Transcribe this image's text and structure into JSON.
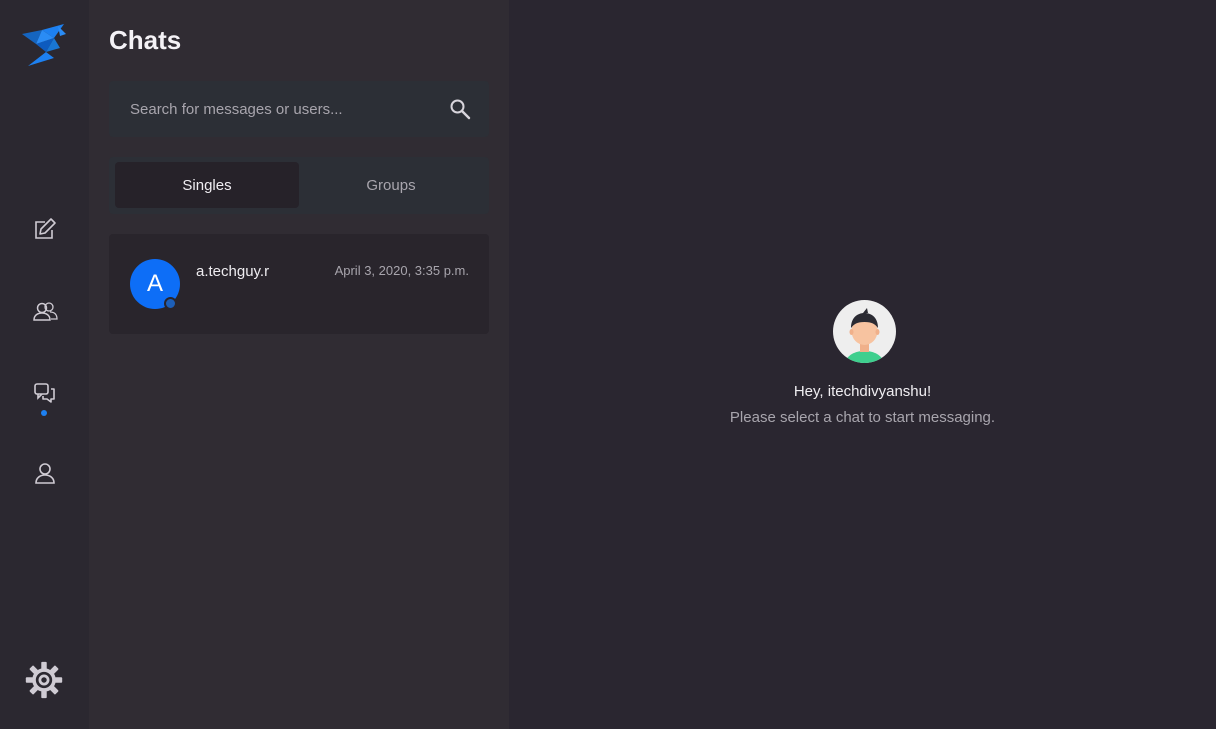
{
  "sidebar": {
    "logo_icon": "bird-logo-icon",
    "nav": [
      {
        "icon": "edit-icon",
        "active": false
      },
      {
        "icon": "users-icon",
        "active": false
      },
      {
        "icon": "chats-icon",
        "active": true
      },
      {
        "icon": "user-icon",
        "active": false
      }
    ],
    "settings_icon": "gear-icon",
    "accent_color": "#1d80f0"
  },
  "chats_panel": {
    "title": "Chats",
    "search": {
      "placeholder": "Search for messages or users...",
      "value": ""
    },
    "tabs": [
      {
        "label": "Singles",
        "active": true
      },
      {
        "label": "Groups",
        "active": false
      }
    ],
    "chat_list": [
      {
        "avatar_letter": "A",
        "name": "a.techguy.r",
        "timestamp": "April 3, 2020, 3:35 p.m.",
        "avatar_color": "#0d6ef7"
      }
    ]
  },
  "main": {
    "greeting": "Hey, itechdivyanshu!",
    "prompt": "Please select a chat to start messaging."
  }
}
